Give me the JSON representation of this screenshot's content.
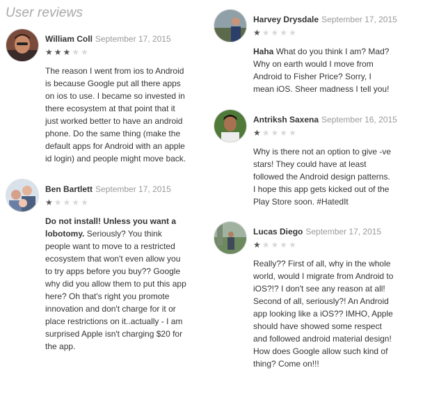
{
  "section_title": "User reviews",
  "reviews_left": [
    {
      "author": "William Coll",
      "date": "September 17, 2015",
      "rating": 3,
      "lead": "",
      "text": "The reason I went from ios to Android is because Google put all there apps on ios to use. I became so invested in there ecosystem at that point that it just worked better to have an android phone. Do the same thing (make the default apps for Android with an apple id login) and people might move back."
    },
    {
      "author": "Ben Bartlett",
      "date": "September 17, 2015",
      "rating": 1,
      "lead": "Do not install! Unless you want a lobotomy.",
      "text": "Seriously? You think people want to move to a restricted ecosystem that won't even allow you to try apps before you buy?? Google why did you allow them to put this app here? Oh that's right you promote innovation and don't charge for it or place restrictions on it..actually - I am surprised Apple isn't charging $20 for the app."
    }
  ],
  "reviews_right": [
    {
      "author": "Harvey Drysdale",
      "date": "September 17, 2015",
      "rating": 1,
      "lead": "Haha",
      "text": "What do you think I am? Mad? Why on earth would I move from Android to Fisher Price? Sorry, I mean iOS. Sheer madness I tell you!"
    },
    {
      "author": "Antriksh Saxena",
      "date": "September 16, 2015",
      "rating": 1,
      "lead": "",
      "text": "Why is there not an option to give -ve stars! They could have at least followed the Android design patterns. I hope this app gets kicked out of the Play Store soon. #HatedIt"
    },
    {
      "author": "Lucas Diego",
      "date": "September 17, 2015",
      "rating": 1,
      "lead": "",
      "text": "Really?? First of all, why in the whole world, would I migrate from Android to iOS?!? I don't see any reason at all! Second of all, seriously?! An Android app looking like a iOS?? IMHO, Apple should have showed some respect and followed android material design! How does Google allow such kind of thing? Come on!!!"
    }
  ],
  "icons": {
    "star_filled": "star-filled-icon",
    "star_empty": "star-empty-icon"
  },
  "colors": {
    "star_filled": "#555555",
    "star_empty": "#d8d8d8",
    "date": "#999999",
    "section_title": "#a8a8a8"
  }
}
